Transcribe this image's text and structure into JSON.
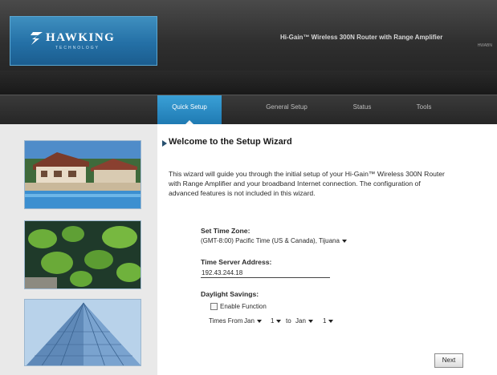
{
  "header": {
    "logo_text": "HAWKING",
    "logo_sub": "TECHNOLOGY",
    "router_title": "Hi-Gain™ Wireless 300N Router with Range Amplifier",
    "router_sub": "HWABN"
  },
  "nav": {
    "tabs": [
      {
        "label": "Quick Setup",
        "active": true
      },
      {
        "label": "General Setup",
        "active": false
      },
      {
        "label": "Status",
        "active": false
      },
      {
        "label": "Tools",
        "active": false
      }
    ]
  },
  "wizard": {
    "title": "Welcome to the Setup Wizard",
    "intro": "This wizard will guide you through the initial setup of your Hi-Gain™ Wireless 300N Router with Range Amplifier and your broadband Internet connection. The configuration of advanced features is not included in this wizard.",
    "time_zone": {
      "label": "Set Time Zone:",
      "value": "(GMT-8:00) Pacific Time (US & Canada), Tijuana"
    },
    "time_server": {
      "label": "Time Server Address:",
      "value": "192.43.244.18"
    },
    "daylight": {
      "label": "Daylight Savings:",
      "enable_label": "Enable Function",
      "enabled": false,
      "times_from_label": "Times From",
      "from_month": "Jan",
      "from_day": "1",
      "to_label": "to",
      "to_month": "Jan",
      "to_day": "1"
    },
    "next_label": "Next"
  },
  "colors": {
    "accent": "#2a8cc7",
    "header_dark": "#2f2f2f",
    "sidebar_bg": "#e9e9e9"
  }
}
